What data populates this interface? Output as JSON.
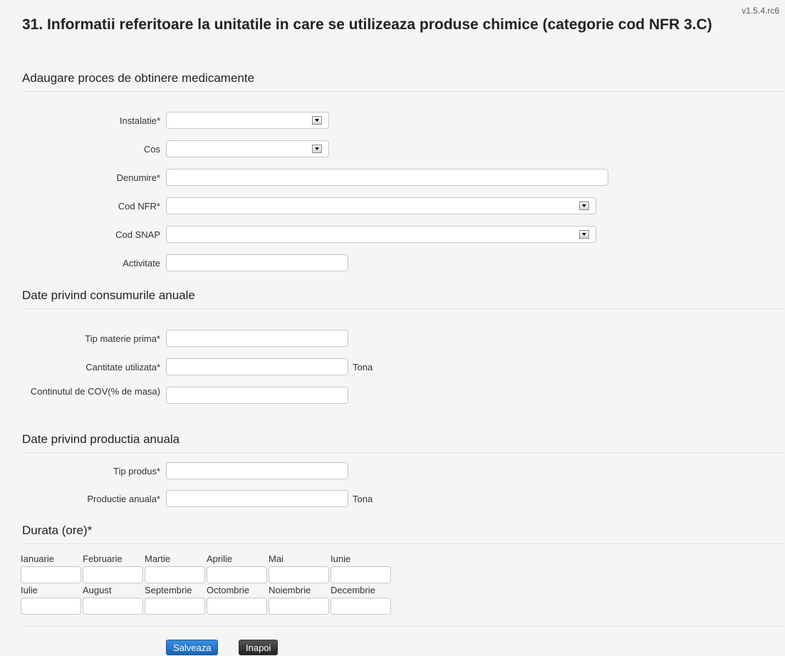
{
  "version": "v1.5.4.rc6",
  "page_title": "31. Informatii referitoare la unitatile in care se utilizeaza produse chimice (categorie cod NFR 3.C)",
  "sections": {
    "process": "Adaugare proces de obtinere medicamente",
    "consumption": "Date privind consumurile anuale",
    "production": "Date privind productia anuala",
    "duration": "Durata (ore)*"
  },
  "fields": {
    "instalatie": {
      "label": "Instalatie*",
      "value": ""
    },
    "cos": {
      "label": "Cos",
      "value": ""
    },
    "denumire": {
      "label": "Denumire*",
      "value": ""
    },
    "cod_nfr": {
      "label": "Cod NFR*",
      "value": ""
    },
    "cod_snap": {
      "label": "Cod SNAP",
      "value": ""
    },
    "activitate": {
      "label": "Activitate",
      "value": ""
    },
    "tip_materie_prima": {
      "label": "Tip materie prima*",
      "value": ""
    },
    "cantitate_utilizata": {
      "label": "Cantitate utilizata*",
      "value": "",
      "unit": "Tona"
    },
    "continut_cov": {
      "label": "Continutul de COV(% de masa)",
      "value": ""
    },
    "tip_produs": {
      "label": "Tip produs*",
      "value": ""
    },
    "productie_anuala": {
      "label": "Productie anuala*",
      "value": "",
      "unit": "Tona"
    }
  },
  "months": [
    "Ianuarie",
    "Februarie",
    "Martie",
    "Aprilie",
    "Mai",
    "Iunie",
    "Iulie",
    "August",
    "Septembrie",
    "Octombrie",
    "Noiembrie",
    "Decembrie"
  ],
  "buttons": {
    "save": "Salveaza",
    "back": "Inapoi"
  }
}
